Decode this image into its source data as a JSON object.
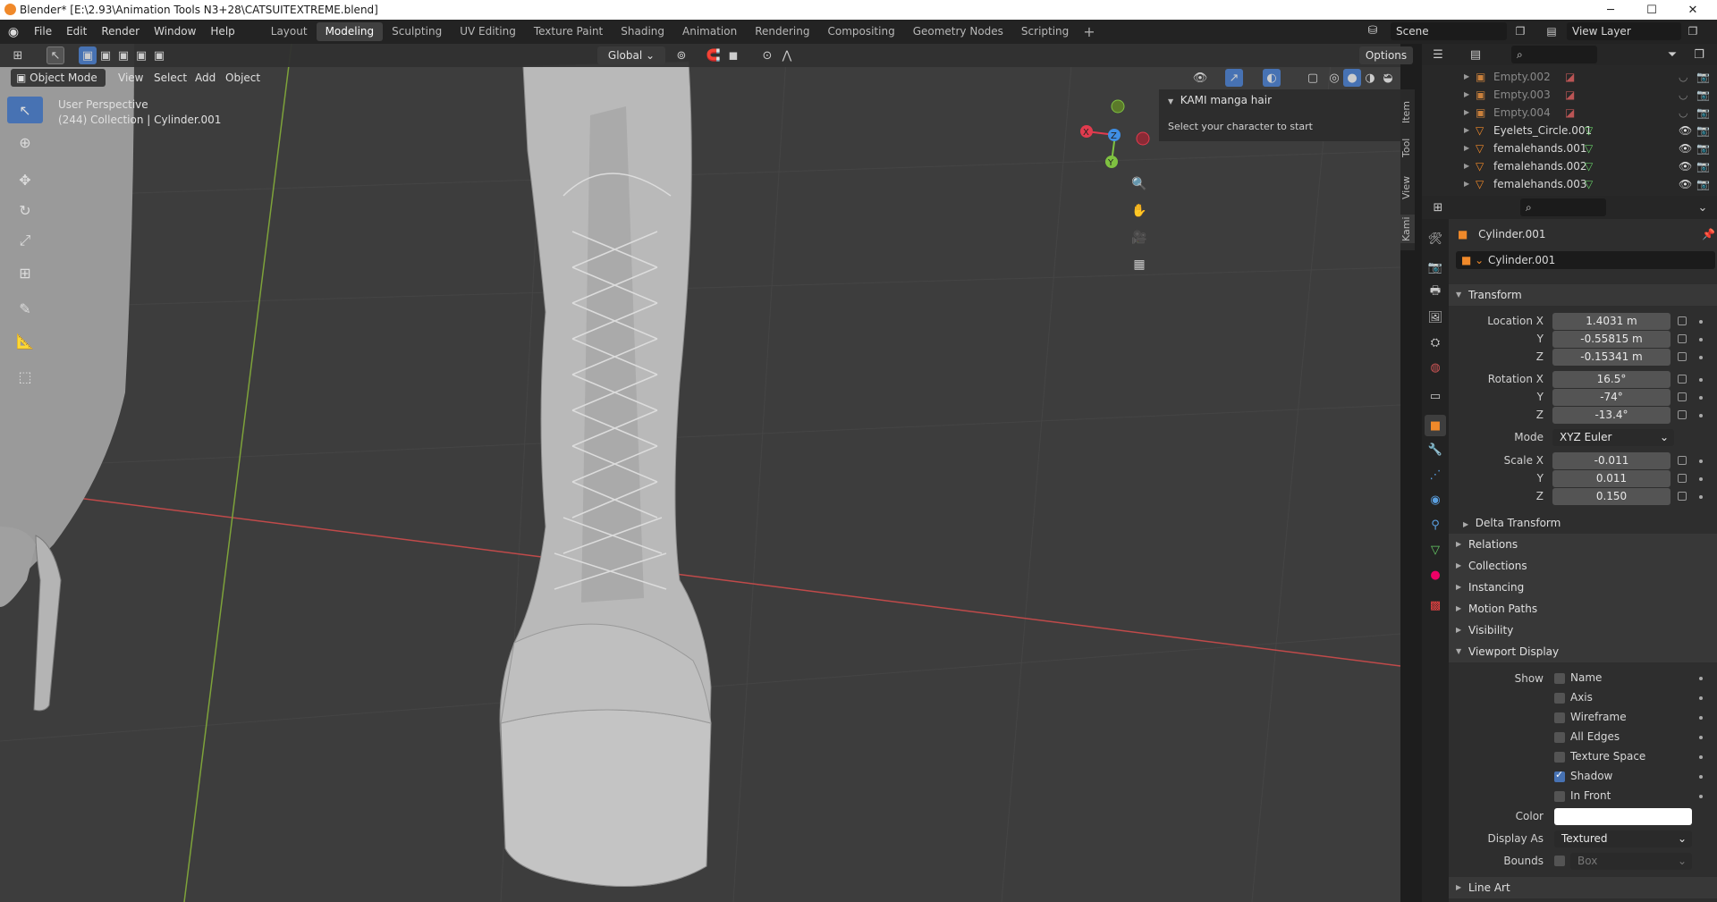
{
  "titlebar": {
    "title": "Blender* [E:\\2.93\\Animation Tools N3+28\\CATSUITEXTREME.blend]",
    "minimize": "─",
    "maximize": "☐",
    "close": "✕"
  },
  "menu": [
    "File",
    "Edit",
    "Render",
    "Window",
    "Help"
  ],
  "workspaces": [
    "Layout",
    "Modeling",
    "Sculpting",
    "UV Editing",
    "Texture Paint",
    "Shading",
    "Animation",
    "Rendering",
    "Compositing",
    "Geometry Nodes",
    "Scripting"
  ],
  "active_workspace": "Modeling",
  "scene": {
    "name": "Scene",
    "view_layer": "View Layer"
  },
  "viewport": {
    "mode": "Object Mode",
    "menus": [
      "View",
      "Select",
      "Add",
      "Object"
    ],
    "orientation": "Global",
    "options": "Options",
    "overlay_line1": "User Perspective",
    "overlay_line2": "(244) Collection | Cylinder.001",
    "gizmo": {
      "x": "X",
      "y": "Y",
      "z": "Z"
    }
  },
  "npanel": {
    "title": "KAMI manga hair",
    "text": "Select your character to start",
    "tabs": [
      "Item",
      "Tool",
      "View",
      "Kami"
    ]
  },
  "outliner": {
    "rows": [
      {
        "name": "Empty.002",
        "type": "empty"
      },
      {
        "name": "Empty.003",
        "type": "empty"
      },
      {
        "name": "Empty.004",
        "type": "empty"
      },
      {
        "name": "Eyelets_Circle.001",
        "type": "mesh"
      },
      {
        "name": "femalehands.001",
        "type": "mesh"
      },
      {
        "name": "femalehands.002",
        "type": "mesh"
      },
      {
        "name": "femalehands.003",
        "type": "mesh"
      }
    ]
  },
  "properties": {
    "object_name": "Cylinder.001",
    "object_field": "Cylinder.001",
    "transform": {
      "title": "Transform",
      "location_label": "Location X",
      "location": [
        "1.4031 m",
        "-0.55815 m",
        "-0.15341 m"
      ],
      "rotation_label": "Rotation X",
      "rotation": [
        "16.5°",
        "-74°",
        "-13.4°"
      ],
      "mode_label": "Mode",
      "mode": "XYZ Euler",
      "scale_label": "Scale X",
      "scale": [
        "-0.011",
        "0.011",
        "0.150"
      ],
      "y": "Y",
      "z": "Z",
      "delta": "Delta Transform"
    },
    "sections": [
      "Relations",
      "Collections",
      "Instancing",
      "Motion Paths",
      "Visibility"
    ],
    "viewport_display": {
      "title": "Viewport Display",
      "show_label": "Show",
      "checks": [
        {
          "label": "Name",
          "on": false
        },
        {
          "label": "Axis",
          "on": false
        },
        {
          "label": "Wireframe",
          "on": false
        },
        {
          "label": "All Edges",
          "on": false
        },
        {
          "label": "Texture Space",
          "on": false
        },
        {
          "label": "Shadow",
          "on": true
        },
        {
          "label": "In Front",
          "on": false
        }
      ],
      "color_label": "Color",
      "display_as_label": "Display As",
      "display_as": "Textured",
      "bounds_label": "Bounds",
      "bounds": "Box"
    },
    "line_art": "Line Art"
  },
  "colors": {
    "accent": "#4772b3",
    "axis_x": "#e23b4e",
    "axis_y": "#7fc241",
    "axis_z": "#3f8fe5"
  }
}
